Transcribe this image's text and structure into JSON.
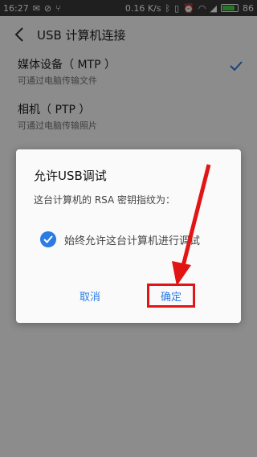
{
  "status_bar": {
    "time": "16:27",
    "network_speed": "0.16 K/s",
    "battery": "86",
    "battery_level": 0.86
  },
  "header": {
    "title": "USB 计算机连接"
  },
  "options": [
    {
      "title": "媒体设备（ MTP ）",
      "subtitle": "可通过电脑传输文件",
      "selected": true
    },
    {
      "title": "相机（ PTP ）",
      "subtitle": "可通过电脑传输照片",
      "selected": false
    }
  ],
  "dialog": {
    "title": "允许USB调试",
    "message": "这台计算机的 RSA 密钥指纹为：",
    "checkbox_label": "始终允许这台计算机进行调试",
    "checkbox_checked": true,
    "cancel_label": "取消",
    "ok_label": "确定"
  },
  "colors": {
    "accent": "#2a7be4",
    "highlight": "#e21515"
  }
}
